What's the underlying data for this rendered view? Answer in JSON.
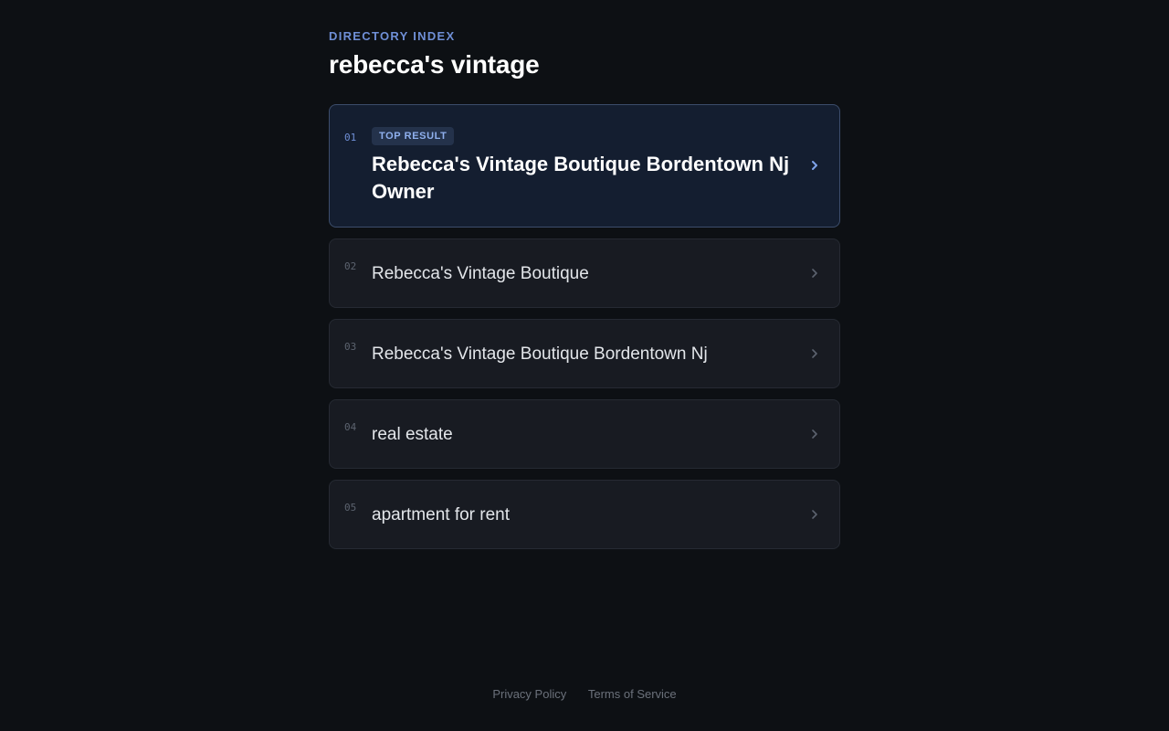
{
  "header": {
    "eyebrow": "DIRECTORY INDEX",
    "title": "rebecca's vintage"
  },
  "results": [
    {
      "num": "01",
      "badge": "TOP RESULT",
      "label": "Rebecca's Vintage Boutique Bordentown Nj Owner"
    },
    {
      "num": "02",
      "label": "Rebecca's Vintage Boutique"
    },
    {
      "num": "03",
      "label": "Rebecca's Vintage Boutique Bordentown Nj"
    },
    {
      "num": "04",
      "label": "real estate"
    },
    {
      "num": "05",
      "label": "apartment for rent"
    }
  ],
  "footer": {
    "privacy": "Privacy Policy",
    "terms": "Terms of Service"
  },
  "colors": {
    "background": "#0d1014",
    "accent": "#6f8fd6",
    "top_card": "#141e30",
    "card": "#181b22"
  },
  "icons": {
    "chevron": "chevron-right-icon"
  }
}
